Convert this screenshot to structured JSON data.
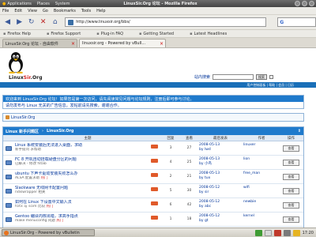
{
  "desktop": {
    "app_menu": "Applications",
    "places_menu": "Places",
    "system_menu": "System",
    "window_title": "LinuxSir.Org 论坛 - Mozilla Firefox"
  },
  "browser": {
    "menu": [
      "File",
      "Edit",
      "View",
      "Go",
      "Bookmarks",
      "Tools",
      "Help"
    ],
    "url": "http://www.linuxsir.org/bbs/",
    "search_engine": "G",
    "bookmarks": [
      "Firefox Help",
      "Firefox Support",
      "Plug-in FAQ",
      "Getting Started",
      "Latest Headlines"
    ],
    "tabs": [
      {
        "label": "LinuxSir.Org 论坛 - 自由软件"
      },
      {
        "label": "linuxsir.org - Powered by vBull..."
      }
    ]
  },
  "site": {
    "logo_pre": "Linux",
    "logo_red": "Sir",
    "logo_post": ".Org",
    "search_label": "站内搜索",
    "search_button": "搜索",
    "top_links": "用户控制面板  |  帮助  |  会员  |  日历"
  },
  "notice": {
    "line1": "欢迎来到 LinuxSir.Org 论坛！如果您是第一次访问，请先阅读常见问题与论坛规则，注册后即可参与讨论。",
    "line2": "请勿发布与 Linux 无关的广告信息，发帖前请先搜索，谢谢合作。"
  },
  "breadcrumb": "LinuxSir.Org",
  "forum": {
    "title_left": "Linux 新手问题区",
    "title_right": "LinuxSir.Org",
    "columns": [
      "",
      "主题",
      "回复",
      "查看",
      "最后发表",
      "作者",
      "操作"
    ],
    "rows": [
      {
        "title": "Linux 系统安装后无法进入桌面，求助",
        "sub": "新手提问 求帮助",
        "hot": "",
        "replies": "3",
        "views": "27",
        "last": "2008-05-13",
        "last_by": "by lwd",
        "author": "linuxer",
        "action": "查看"
      },
      {
        "title": "FC 8 开机自动挂载硬盘分区的问题",
        "sub": "已解决 - 修改 fstab",
        "hot": "",
        "replies": "4",
        "views": "25",
        "last": "2008-05-13",
        "last_by": "by 小鸟",
        "author": "lion",
        "action": "查看"
      },
      {
        "title": "ubuntu 下声卡驱动安装失败怎么办",
        "sub": "ALSA 配置求助",
        "hot": "热门",
        "replies": "2",
        "views": "21",
        "last": "2008-05-13",
        "last_by": "by tux",
        "author": "free_man",
        "action": "查看"
      },
      {
        "title": "Slackware 无线网卡配置问题",
        "sub": "ndiswrapper 相关",
        "hot": "",
        "replies": "5",
        "views": "30",
        "last": "2008-05-12",
        "last_by": "by sir",
        "author": "wifi",
        "action": "查看"
      },
      {
        "title": "如何在 Linux 下设置中文输入法",
        "sub": "fcitx 与 scim 比较",
        "hot": "热门",
        "replies": "6",
        "views": "42",
        "last": "2008-05-12",
        "last_by": "by abc",
        "author": "newbie",
        "action": "查看"
      },
      {
        "title": "Gentoo 编译内核出错，求高手指点",
        "sub": "make menuconfig 问题",
        "hot": "热门",
        "replies": "1",
        "views": "18",
        "last": "2008-05-12",
        "last_by": "by gt",
        "author": "kernel",
        "action": "查看"
      }
    ]
  },
  "taskbar": {
    "window_label": "LinuxSir.Org - Powered by vBulletin",
    "clock": "17:20"
  },
  "colors": {
    "accent_blue": "#1f7acc",
    "link_blue": "#00349a",
    "hot_red": "#d21f1f"
  }
}
